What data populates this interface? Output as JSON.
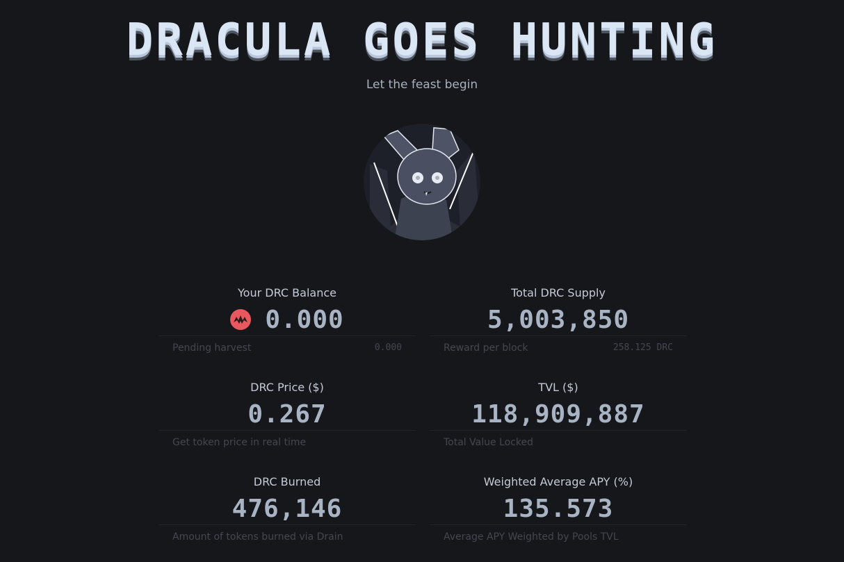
{
  "header": {
    "title": "DRACULA GOES HUNTING",
    "subtitle": "Let the feast begin"
  },
  "logo": {
    "icon": "bat-mascot-icon"
  },
  "stats": {
    "balance": {
      "label": "Your DRC Balance",
      "value": "0.000",
      "icon": "drc-token-icon",
      "footer_label": "Pending harvest",
      "footer_value": "0.000"
    },
    "supply": {
      "label": "Total DRC Supply",
      "value": "5,003,850",
      "footer_label": "Reward per block",
      "footer_value": "258.125 DRC"
    },
    "price": {
      "label": "DRC Price ($)",
      "value": "0.267",
      "footer_label": "Get token price in real time"
    },
    "tvl": {
      "label": "TVL ($)",
      "value": "118,909,887",
      "footer_label": "Total Value Locked"
    },
    "burned": {
      "label": "DRC Burned",
      "value": "476,146",
      "footer_label": "Amount of tokens burned via Drain"
    },
    "apy": {
      "label": "Weighted Average APY (%)",
      "value": "135.573",
      "footer_label": "Average APY Weighted by Pools TVL"
    }
  },
  "colors": {
    "background": "#16171b",
    "title": "#dbe6f5",
    "value": "#a8b3c3",
    "token": "#e8585e"
  }
}
